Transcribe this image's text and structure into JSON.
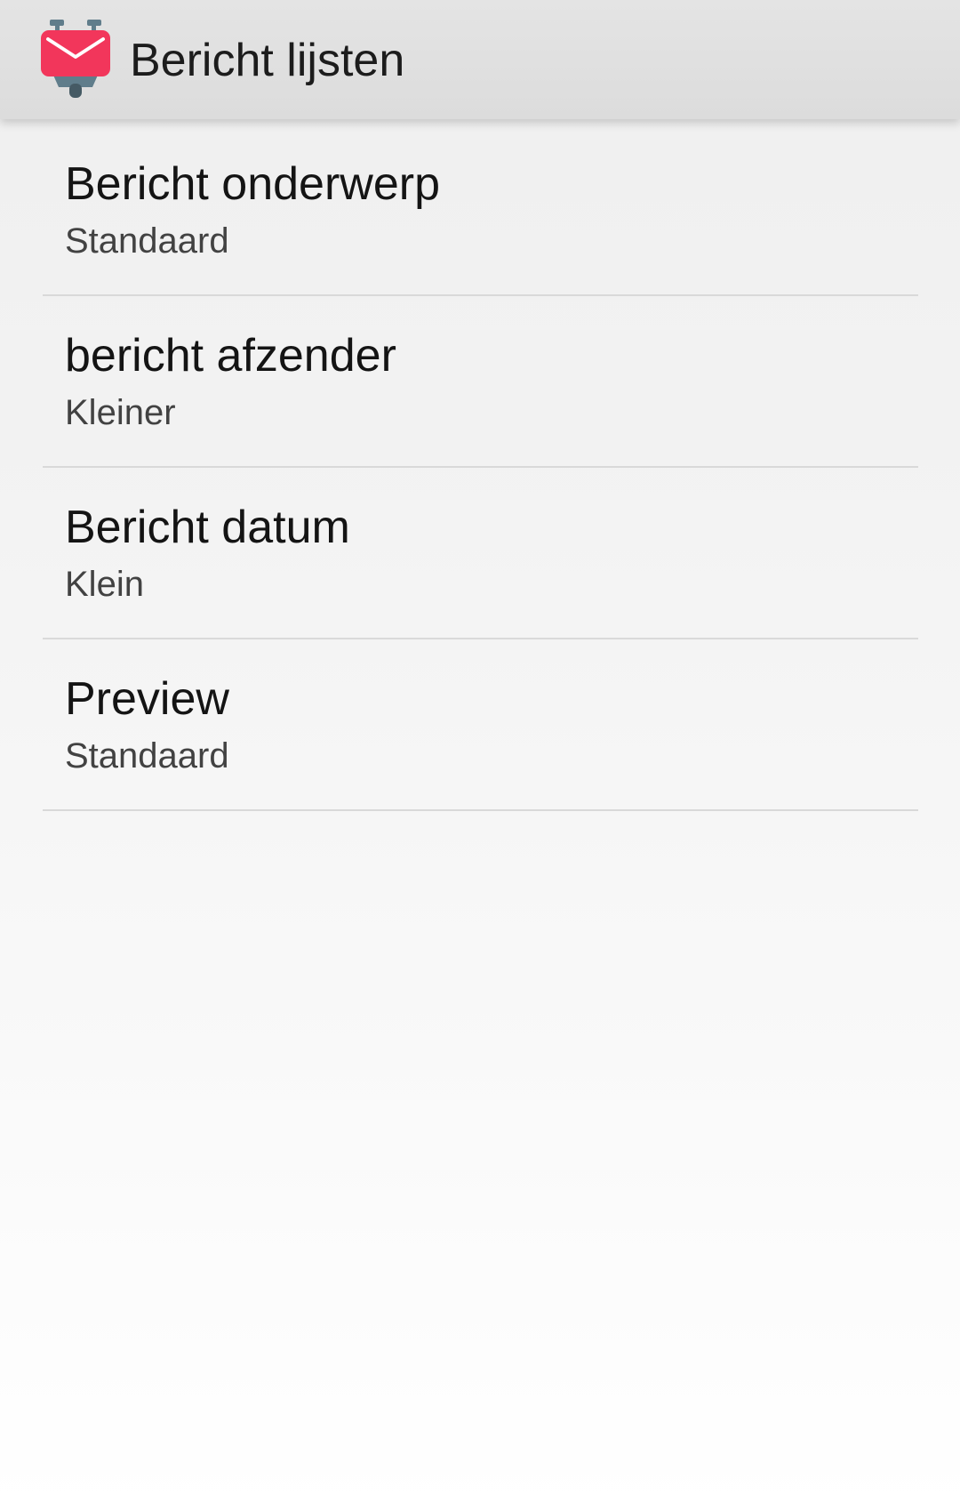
{
  "app_bar": {
    "title": "Bericht lijsten",
    "icon": "k9-mail-app-icon",
    "icon_color": "#f2365b"
  },
  "preferences": [
    {
      "title": "Bericht onderwerp",
      "summary": "Standaard"
    },
    {
      "title": "bericht afzender",
      "summary": "Kleiner"
    },
    {
      "title": "Bericht datum",
      "summary": "Klein"
    },
    {
      "title": "Preview",
      "summary": "Standaard"
    }
  ]
}
